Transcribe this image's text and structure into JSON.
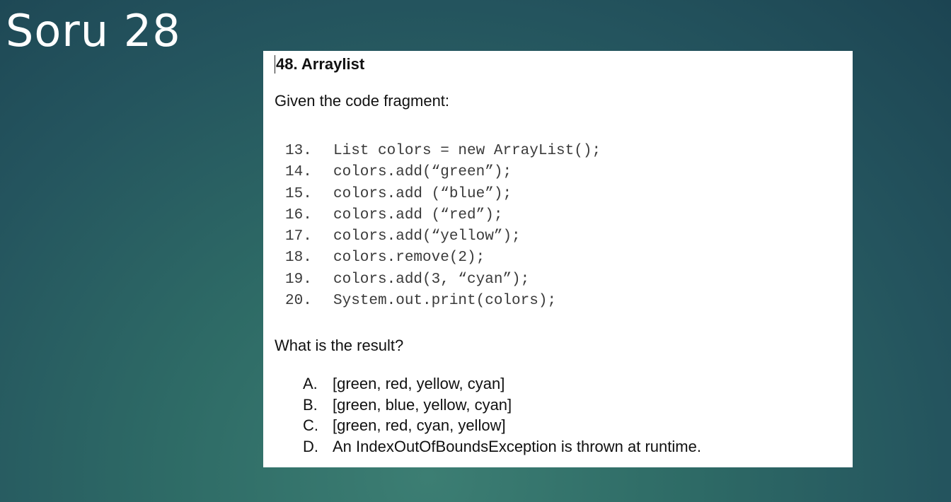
{
  "slide": {
    "title": "Soru 28"
  },
  "question": {
    "heading": "48. Arraylist",
    "intro": "Given the code fragment:",
    "code": [
      {
        "num": "13.",
        "text": "List colors = new ArrayList();"
      },
      {
        "num": "14.",
        "text": "colors.add(“green”);"
      },
      {
        "num": "15.",
        "text": "colors.add (“blue”);"
      },
      {
        "num": "16.",
        "text": "colors.add (“red”);"
      },
      {
        "num": "17.",
        "text": "colors.add(“yellow”);"
      },
      {
        "num": "18.",
        "text": "colors.remove(2);"
      },
      {
        "num": "19.",
        "text": "colors.add(3, “cyan”);"
      },
      {
        "num": "20.",
        "text": "System.out.print(colors);"
      }
    ],
    "prompt": "What is the result?",
    "options": [
      {
        "letter": "A.",
        "text": "[green, red, yellow, cyan]"
      },
      {
        "letter": "B.",
        "text": "[green, blue, yellow, cyan]"
      },
      {
        "letter": "C.",
        "text": "[green, red, cyan, yellow]"
      },
      {
        "letter": "D.",
        "text": "An IndexOutOfBoundsException is thrown at runtime."
      }
    ]
  }
}
